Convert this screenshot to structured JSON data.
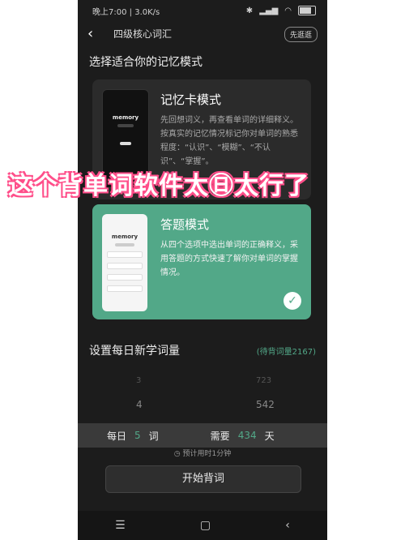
{
  "status": {
    "time": "晚上7:00",
    "speed": "3.0K/s",
    "battery": "75"
  },
  "header": {
    "title": "四级核心词汇",
    "skip_label": "先逛逛"
  },
  "section": {
    "title": "选择适合你的记忆模式"
  },
  "modes": [
    {
      "title": "记忆卡模式",
      "description": "先回想词义，再查看单词的详细释义。按真实的记忆情况标记你对单词的熟悉程度：“认识”、“模糊”、“不认识”、“掌握”。",
      "thumb_label": "memory"
    },
    {
      "title": "答题模式",
      "description": "从四个选项中选出单词的正确释义，采用答题的方式快速了解你对单词的掌握情况。",
      "thumb_label": "memory"
    }
  ],
  "overlay_text": "这个背单词软件太㊐太行了",
  "daily": {
    "title": "设置每日新学词量",
    "pending": "(待背词量2167)",
    "left_values": [
      "3",
      "4"
    ],
    "right_values": [
      "723",
      "542"
    ],
    "per_day_label": "每日",
    "per_day_value": "5",
    "per_day_unit": "词",
    "need_label": "需要",
    "need_value": "434",
    "need_unit": "天",
    "estimate": "预计用时1分钟"
  },
  "start_button": "开始背词",
  "navbar": {
    "menu": "☰",
    "home": "▢",
    "back": "‹"
  },
  "colors": {
    "accent": "#52a888",
    "background": "#1c1c1c",
    "overlay_outline": "#ff4f8a"
  }
}
